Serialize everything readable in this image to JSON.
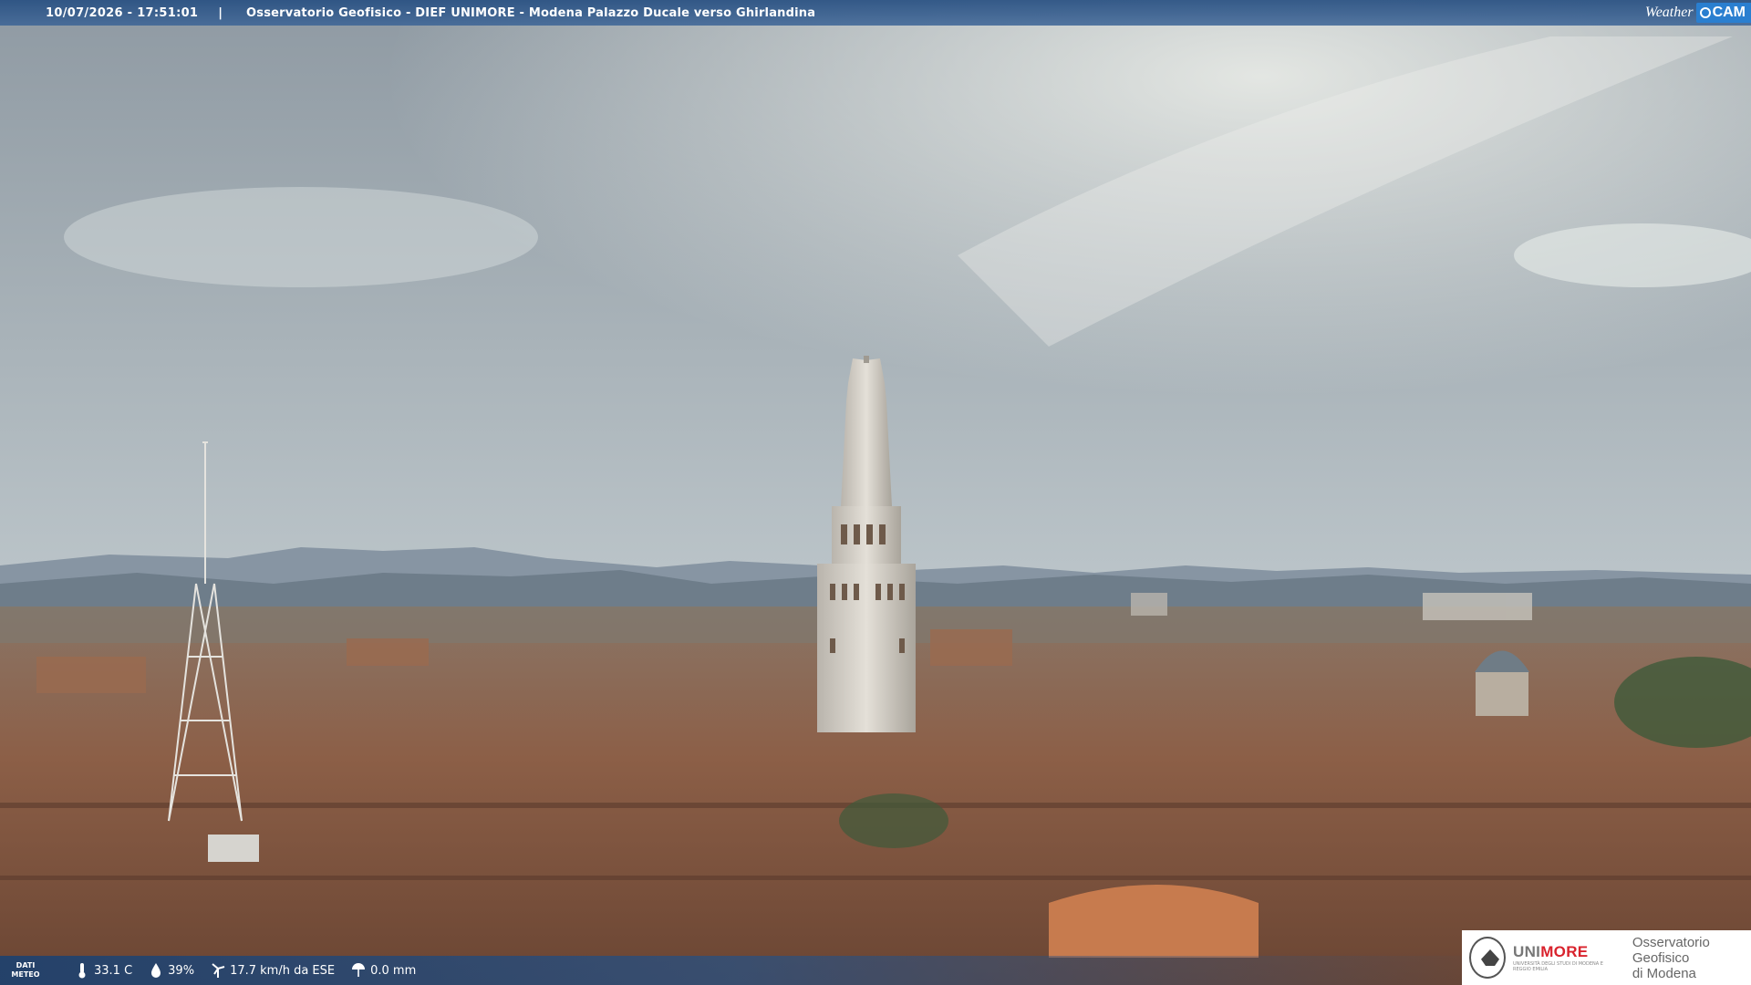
{
  "header": {
    "timestamp": "10/07/2026 - 17:51:01",
    "separator": "|",
    "title": "Osservatorio Geofisico - DIEF UNIMORE - Modena Palazzo Ducale verso Ghirlandina"
  },
  "brand": {
    "weather": "Weather",
    "cam": "CAM",
    "color": "#2a7fd0"
  },
  "weather_data": {
    "label_line1": "DATI",
    "label_line2": "METEO",
    "temperature": "33.1 C",
    "humidity": "39%",
    "wind": "17.7 km/h da ESE",
    "rain": "0.0 mm"
  },
  "logo": {
    "unimore_prefix": "UNI",
    "unimore_suffix": "MORE",
    "unimore_sub": "UNIVERSITÀ DEGLI STUDI DI MODENA E REGGIO EMILIA",
    "observatory_line1": "Osservatorio Geofisico",
    "observatory_line2": "di Modena"
  },
  "icons": {
    "temperature": "thermometer-icon",
    "humidity": "droplet-icon",
    "wind": "wind-turbine-icon",
    "rain": "umbrella-icon"
  }
}
